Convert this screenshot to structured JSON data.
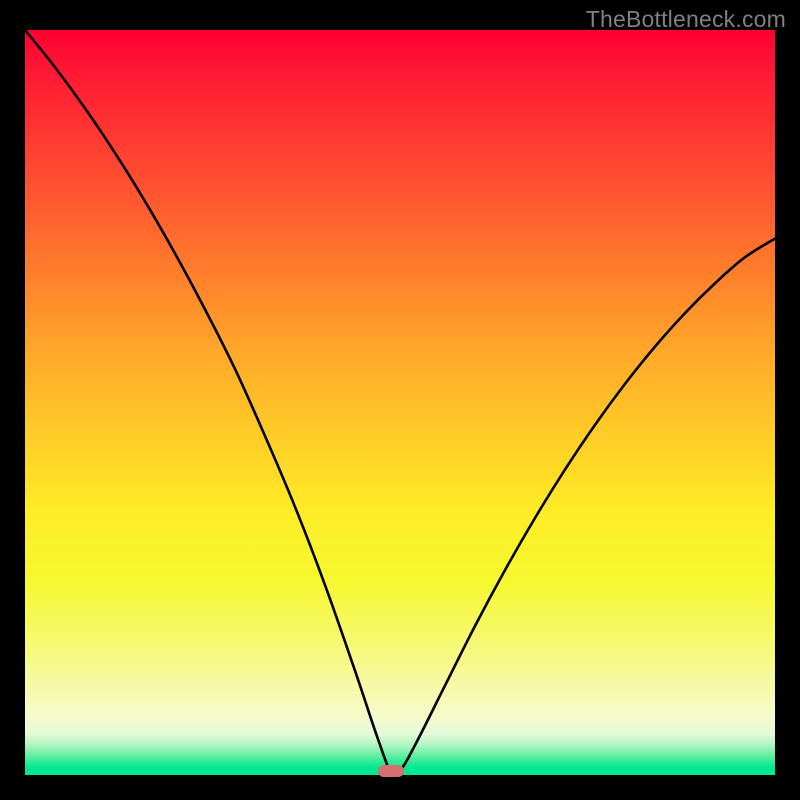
{
  "watermark": {
    "text": "TheBottleneck.com"
  },
  "colors": {
    "frame": "#000000",
    "watermark": "#808080",
    "curve": "#000000",
    "marker": "#d6706f",
    "gradient_top": "#ff0033",
    "gradient_bottom": "#00e890"
  },
  "chart_data": {
    "type": "line",
    "title": "",
    "xlabel": "",
    "ylabel": "",
    "xlim": [
      0,
      100
    ],
    "ylim": [
      0,
      100
    ],
    "grid": false,
    "legend": false,
    "annotations": [
      {
        "text": "TheBottleneck.com",
        "role": "watermark",
        "position": "top-right"
      }
    ],
    "x": [
      0,
      4,
      8,
      12,
      16,
      20,
      24,
      28,
      32,
      36,
      40,
      44,
      47,
      48.8,
      50,
      52,
      56,
      60,
      64,
      68,
      72,
      76,
      80,
      84,
      88,
      92,
      96,
      100
    ],
    "values": [
      100,
      95,
      89.5,
      83.5,
      77,
      70,
      62.5,
      54.5,
      45.5,
      36,
      25.5,
      14,
      5,
      0.4,
      0.6,
      4,
      12,
      20,
      27.5,
      34.5,
      41,
      47,
      52.5,
      57.5,
      62,
      66,
      69.5,
      72
    ],
    "marker": {
      "x": 48.8,
      "y": 0.5
    },
    "note": "Values are read off the image; y is percent of plot height from bottom (0 = bottom green band, 100 = top red)."
  }
}
